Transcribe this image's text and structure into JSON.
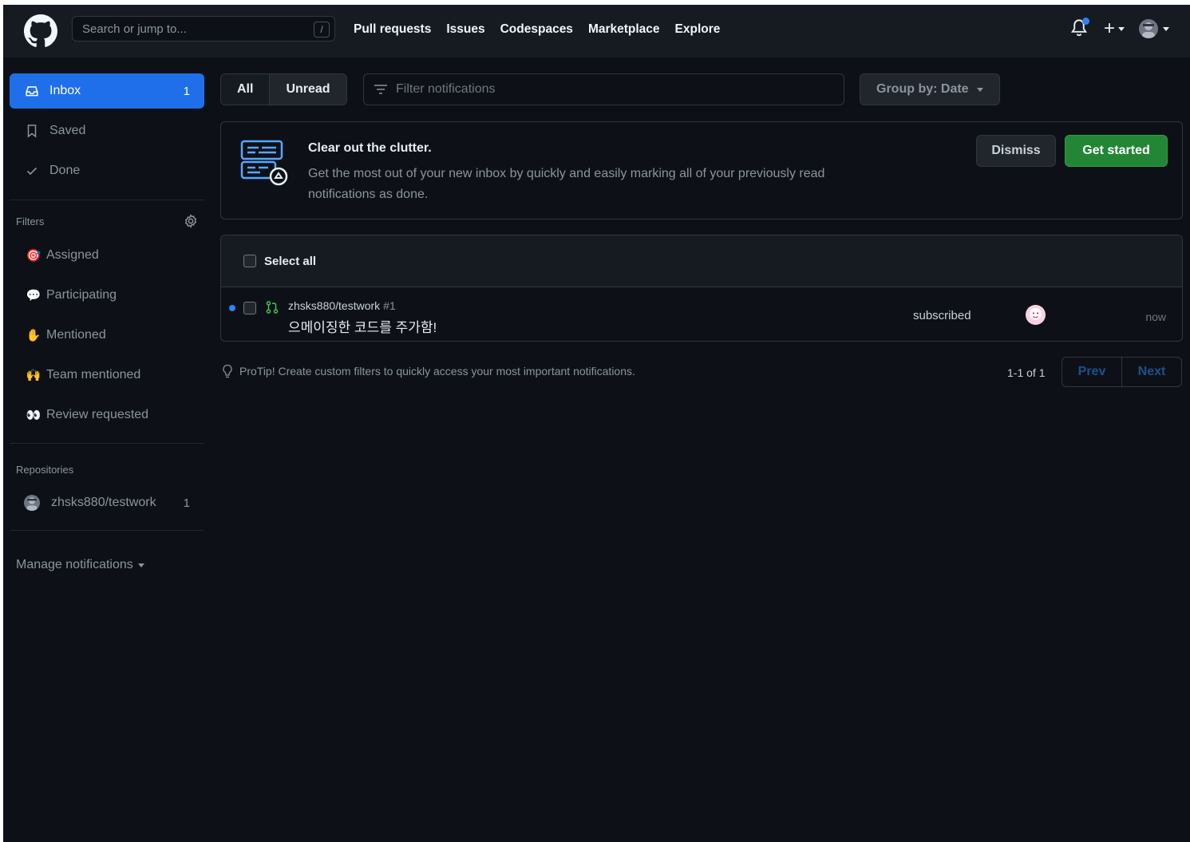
{
  "header": {
    "search_placeholder": "Search or jump to...",
    "search_shortcut": "/",
    "nav": [
      "Pull requests",
      "Issues",
      "Codespaces",
      "Marketplace",
      "Explore"
    ],
    "new_label": "+"
  },
  "sidebar": {
    "items": [
      {
        "label": "Inbox",
        "count": "1",
        "icon": "inbox-icon"
      },
      {
        "label": "Saved",
        "icon": "bookmark-icon"
      },
      {
        "label": "Done",
        "icon": "check-icon"
      }
    ],
    "filters_label": "Filters",
    "filters": [
      {
        "label": "Assigned",
        "emoji": "🎯"
      },
      {
        "label": "Participating",
        "emoji": "💬"
      },
      {
        "label": "Mentioned",
        "emoji": "✋"
      },
      {
        "label": "Team mentioned",
        "emoji": "🙌"
      },
      {
        "label": "Review requested",
        "emoji": "👀"
      }
    ],
    "repositories_label": "Repositories",
    "repositories": [
      {
        "name": "zhsks880/testwork",
        "count": "1"
      }
    ],
    "manage_label": "Manage notifications"
  },
  "toolbar": {
    "all_label": "All",
    "unread_label": "Unread",
    "filter_placeholder": "Filter notifications",
    "group_by_label": "Group by: Date"
  },
  "banner": {
    "title": "Clear out the clutter.",
    "description": "Get the most out of your new inbox by quickly and easily marking all of your previously read notifications as done.",
    "dismiss_label": "Dismiss",
    "get_started_label": "Get started"
  },
  "list": {
    "select_all_label": "Select all",
    "notifications": [
      {
        "repo": "zhsks880/testwork",
        "number": "#1",
        "title": "으메이징한 코드를 주가함!",
        "reason": "subscribed",
        "time": "now"
      }
    ]
  },
  "footer": {
    "protip": "ProTip! Create custom filters to quickly access your most important notifications.",
    "range": "1-1 of 1",
    "prev_label": "Prev",
    "next_label": "Next"
  },
  "colors": {
    "background": "#0d1117",
    "header": "#161b22",
    "accent": "#1f6feb",
    "primary_button": "#238636",
    "unread_dot": "#2f81f7"
  }
}
